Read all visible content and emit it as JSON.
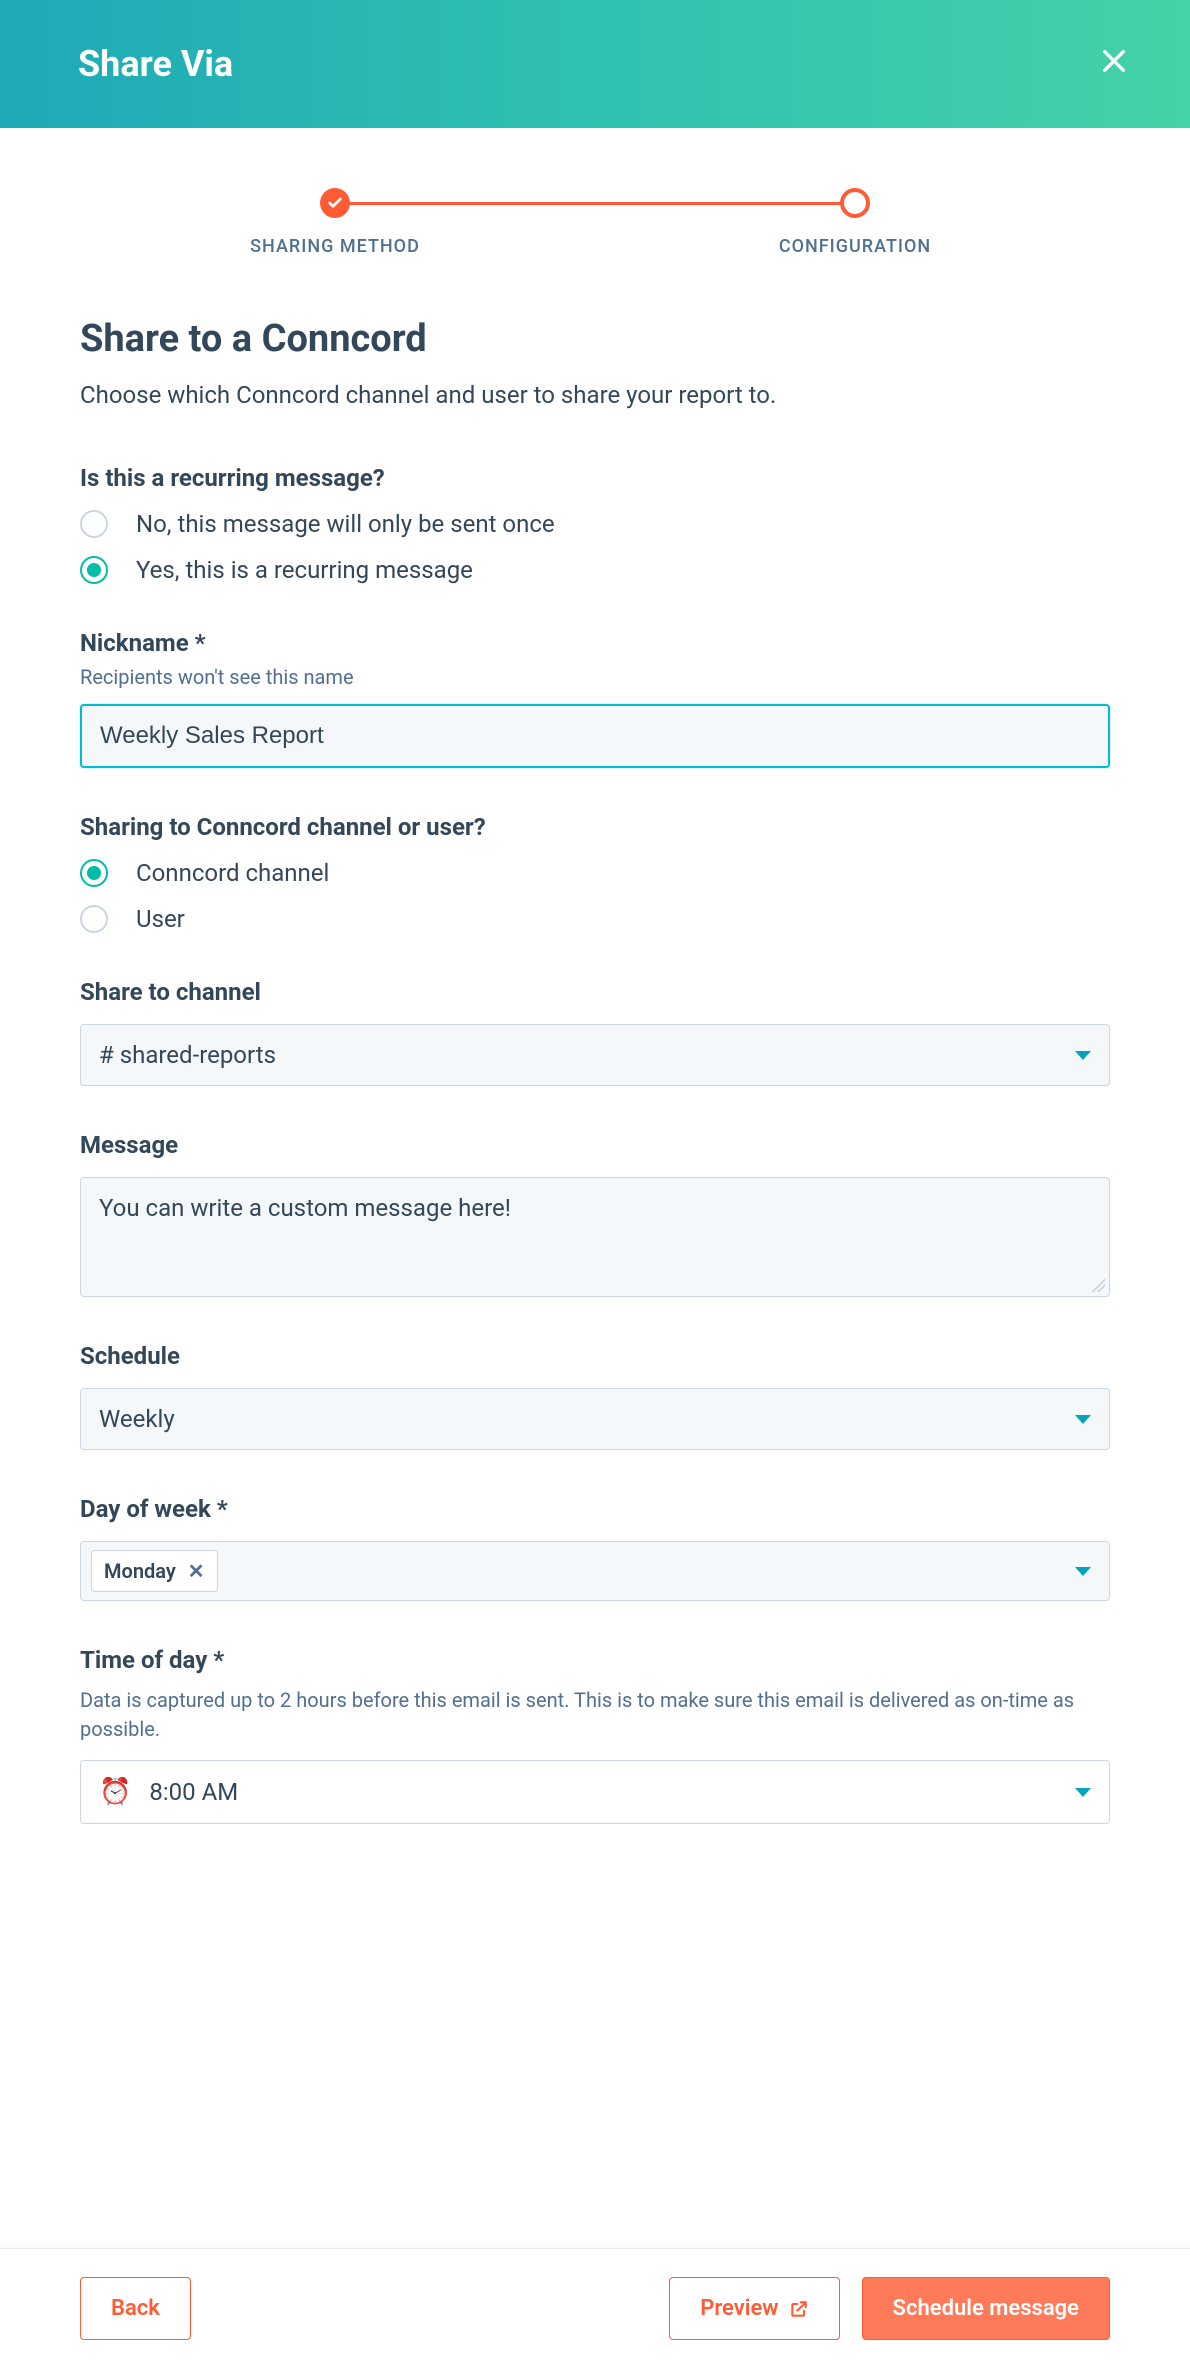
{
  "header": {
    "title": "Share Via"
  },
  "stepper": {
    "steps": [
      {
        "label": "SHARING METHOD",
        "state": "done"
      },
      {
        "label": "CONFIGURATION",
        "state": "current"
      }
    ]
  },
  "page": {
    "title": "Share to a Conncord",
    "subtitle": "Choose which Conncord channel and user to share your report to."
  },
  "recurring": {
    "label": "Is this a recurring message?",
    "options": {
      "no": "No, this message will only be sent once",
      "yes": "Yes, this is a recurring message"
    },
    "selected": "yes"
  },
  "nickname": {
    "label": "Nickname *",
    "help": "Recipients won't see this name",
    "value": "Weekly Sales Report"
  },
  "target": {
    "label": "Sharing to Conncord channel or user?",
    "options": {
      "channel": "Conncord channel",
      "user": "User"
    },
    "selected": "channel"
  },
  "channel": {
    "label": "Share to channel",
    "value": "# shared-reports"
  },
  "message": {
    "label": "Message",
    "value": "You can write a custom message here!"
  },
  "schedule": {
    "label": "Schedule",
    "value": "Weekly"
  },
  "dayOfWeek": {
    "label": "Day of week *",
    "chip": "Monday"
  },
  "timeOfDay": {
    "label": "Time of day *",
    "help": "Data is captured up to 2 hours before this email is sent. This is to make sure this email is delivered as on-time as possible.",
    "value": "8:00 AM"
  },
  "footer": {
    "back": "Back",
    "preview": "Preview",
    "submit": "Schedule message"
  }
}
